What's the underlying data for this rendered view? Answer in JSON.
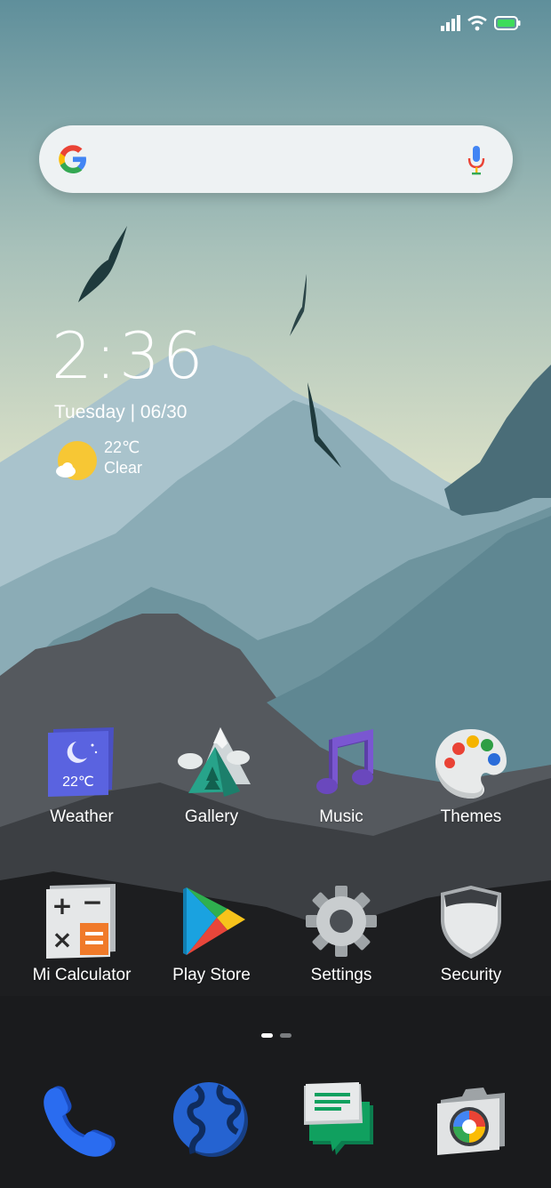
{
  "status_bar": {
    "icons": [
      "signal-icon",
      "wifi-icon",
      "battery-icon"
    ],
    "battery_color": "#3ddc5a"
  },
  "search": {
    "logo": "google-g-logo",
    "mic": "microphone-icon"
  },
  "clock": {
    "time": "2:36",
    "date": "Tuesday | 06/30"
  },
  "weather": {
    "temperature": "22℃",
    "condition": "Clear",
    "icon": "sun-cloud-icon"
  },
  "home_apps": [
    {
      "label": "Weather",
      "icon": "weather-icon",
      "badge": "22℃"
    },
    {
      "label": "Gallery",
      "icon": "gallery-icon"
    },
    {
      "label": "Music",
      "icon": "music-icon"
    },
    {
      "label": "Themes",
      "icon": "themes-icon"
    },
    {
      "label": "Mi Calculator",
      "icon": "calculator-icon"
    },
    {
      "label": "Play Store",
      "icon": "play-store-icon"
    },
    {
      "label": "Settings",
      "icon": "settings-icon"
    },
    {
      "label": "Security",
      "icon": "security-icon"
    }
  ],
  "page_indicator": {
    "pages": 2,
    "current": 1
  },
  "dock": [
    {
      "icon": "phone-icon"
    },
    {
      "icon": "browser-icon"
    },
    {
      "icon": "messages-icon"
    },
    {
      "icon": "camera-icon"
    }
  ],
  "colors": {
    "sky_top": "#5f8f9b",
    "sky_bottom": "#d8dfc5",
    "mountain_far": "#a5bfc8",
    "mountain_mid": "#7fa3ad",
    "mountain_dark": "#4b6e79",
    "foreground": "#1a1b1d"
  }
}
